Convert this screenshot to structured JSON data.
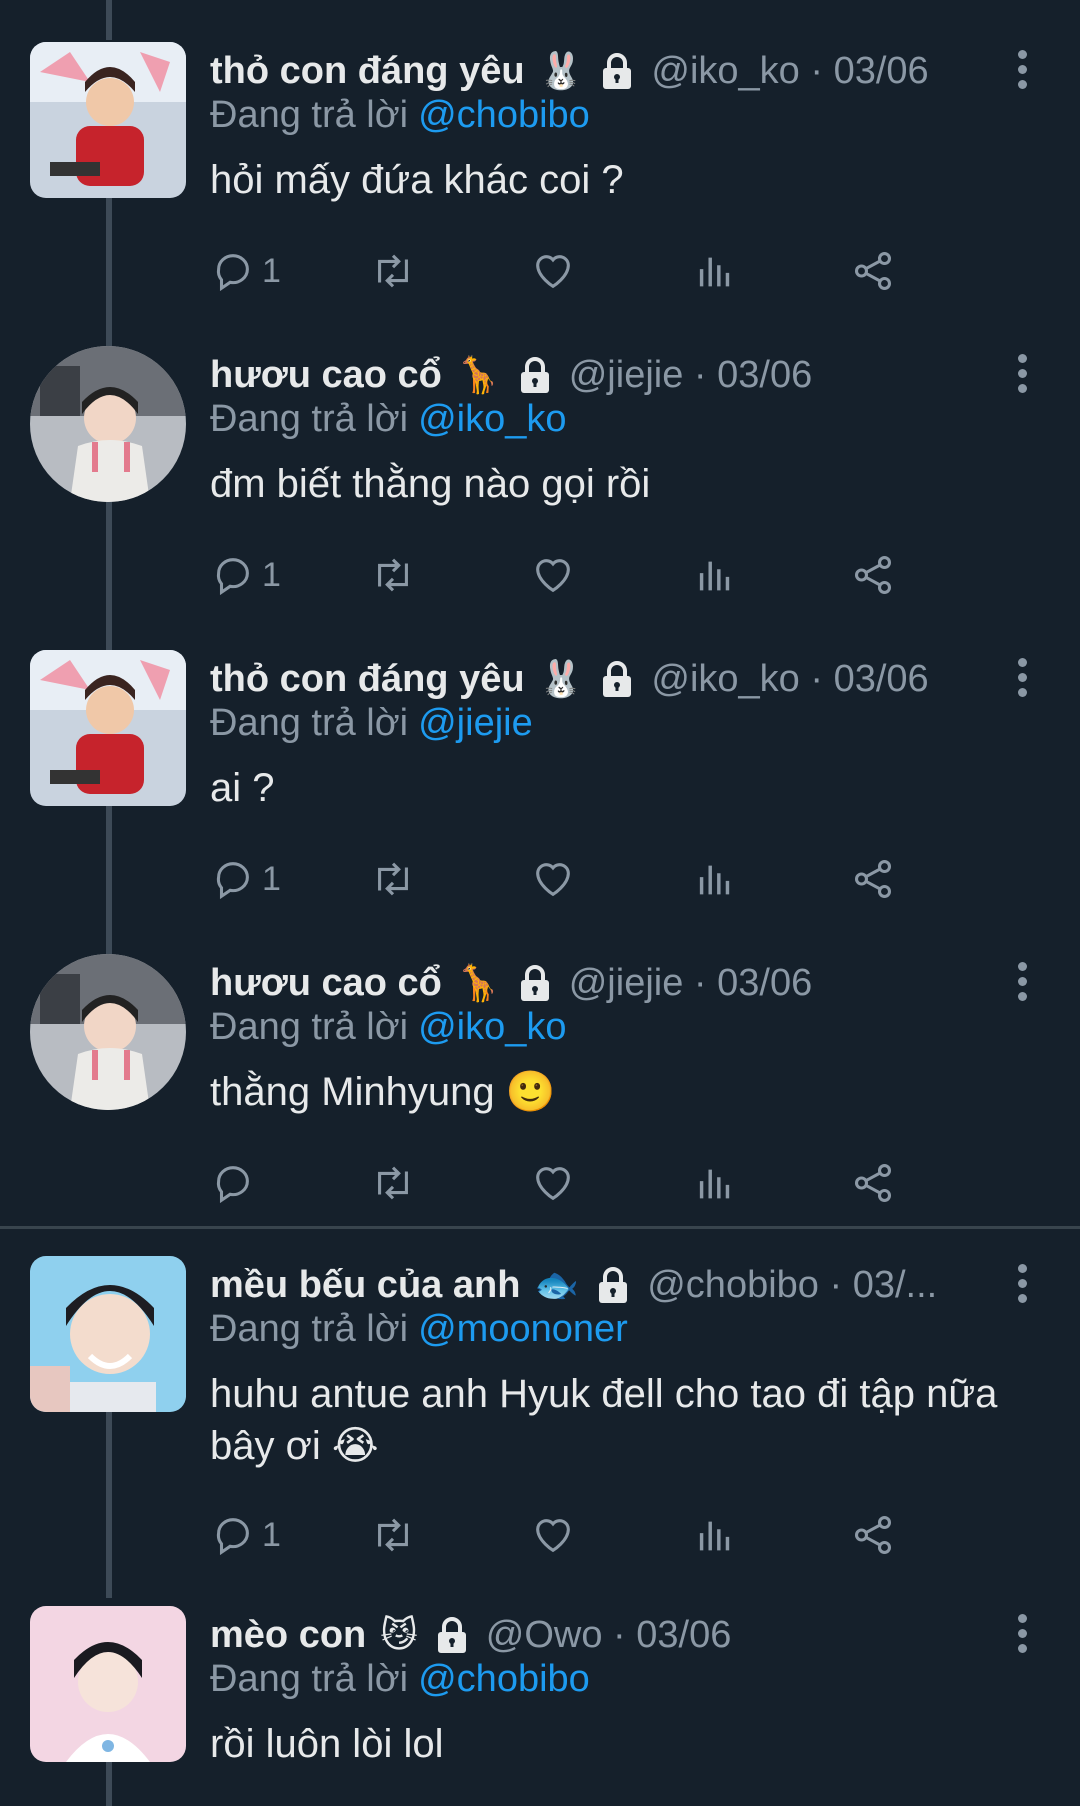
{
  "tweets": [
    {
      "name": "thỏ con đáng yêu",
      "emoji": "🐰",
      "handle": "@iko_ko · 03/06",
      "reply_prefix": "Đang trả lời",
      "reply_to": "@chobibo",
      "text": "hỏi mấy đứa khác coi ?",
      "reply_count": "1"
    },
    {
      "name": "hươu cao cổ",
      "emoji": "🦒",
      "handle": "@jiejie · 03/06",
      "reply_prefix": "Đang trả lời",
      "reply_to": "@iko_ko",
      "text": "đm biết thằng nào gọi rồi",
      "reply_count": "1"
    },
    {
      "name": "thỏ con đáng yêu",
      "emoji": "🐰",
      "handle": "@iko_ko · 03/06",
      "reply_prefix": "Đang trả lời",
      "reply_to": "@jiejie",
      "text": "ai ?",
      "reply_count": "1"
    },
    {
      "name": "hươu cao cổ",
      "emoji": "🦒",
      "handle": "@jiejie · 03/06",
      "reply_prefix": "Đang trả lời",
      "reply_to": "@iko_ko",
      "text": "thằng Minhyung 🙂",
      "reply_count": ""
    },
    {
      "name": "mều bếu của anh",
      "emoji": "🐟",
      "handle": "@chobibo · 03/...",
      "reply_prefix": "Đang trả lời",
      "reply_to": "@moononer",
      "text": "huhu antue anh Hyuk đell cho tao đi tập nữa bây ơi 😭",
      "reply_count": "1"
    },
    {
      "name": "mèo con",
      "emoji": "😼",
      "handle": "@Owo · 03/06",
      "reply_prefix": "Đang trả lời",
      "reply_to": "@chobibo",
      "text": "rồi luôn lòi lol"
    }
  ],
  "colors": {
    "background": "#15202b",
    "text": "#e7e9ea",
    "muted": "#8b98a5",
    "accent": "#1d9bf0",
    "thread_line": "#3d4a57"
  },
  "icons": {
    "lock": "lock-icon",
    "more": "more-vertical-icon",
    "reply": "reply-icon",
    "retweet": "retweet-icon",
    "like": "heart-icon",
    "views": "views-icon",
    "share": "share-icon"
  }
}
